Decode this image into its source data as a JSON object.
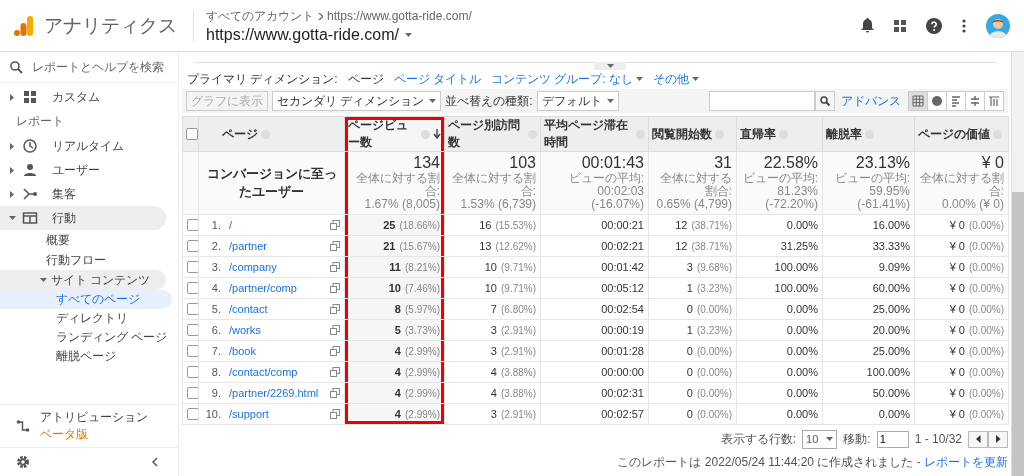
{
  "header": {
    "app_name": "アナリティクス",
    "breadcrumb": [
      "すべてのアカウント",
      "https://www.gotta-ride.com/"
    ],
    "property": "https://www.gotta-ride.com/"
  },
  "sidebar": {
    "search_placeholder": "レポートとヘルプを検索",
    "items": [
      {
        "kind": "item",
        "label": "カスタム",
        "expanded": false
      },
      {
        "kind": "section",
        "label": "レポート"
      },
      {
        "kind": "item",
        "label": "リアルタイム",
        "expanded": false
      },
      {
        "kind": "item",
        "label": "ユーザー",
        "expanded": false
      },
      {
        "kind": "item",
        "label": "集客",
        "expanded": false
      },
      {
        "kind": "item",
        "label": "行動",
        "expanded": true,
        "children": [
          {
            "label": "概要",
            "selected": false
          },
          {
            "label": "行動フロー",
            "selected": false
          },
          {
            "label": "サイト コンテンツ",
            "expanded": true,
            "children": [
              {
                "label": "すべてのページ",
                "selected": true
              },
              {
                "label": "ディレクトリ",
                "selected": false
              },
              {
                "label": "ランディング ページ",
                "selected": false
              },
              {
                "label": "離脱ページ",
                "selected": false
              }
            ]
          }
        ]
      }
    ],
    "bottom_item": {
      "label": "アトリビューション",
      "badge": "ベータ版"
    }
  },
  "dimension_bar": {
    "label": "プライマリ ディメンション:",
    "options": [
      {
        "label": "ページ",
        "selected": true,
        "dropdown": false
      },
      {
        "label": "ページ タイトル",
        "selected": false,
        "dropdown": false
      },
      {
        "label": "コンテンツ グループ: なし",
        "selected": false,
        "dropdown": true
      },
      {
        "label": "その他",
        "selected": false,
        "dropdown": true
      }
    ]
  },
  "toolbar": {
    "chart_button": {
      "label": "グラフに表示",
      "disabled": true
    },
    "secondary_dimension": "セカンダリ ディメンション",
    "sort_label": "並べ替えの種類:",
    "sort_value": "デフォルト",
    "advanced_link": "アドバンス",
    "views": [
      {
        "kind": "table",
        "selected": true
      },
      {
        "kind": "pie",
        "selected": false
      },
      {
        "kind": "bar",
        "selected": false
      },
      {
        "kind": "compare",
        "selected": false
      },
      {
        "kind": "pivot",
        "selected": false
      }
    ]
  },
  "table": {
    "all_checked": false,
    "columns": [
      {
        "label": "ページ",
        "sorted": false,
        "highlighted": false
      },
      {
        "label": "ページビュー数",
        "sorted": true,
        "highlighted": true
      },
      {
        "label": "ページ別訪問数",
        "sorted": false,
        "highlighted": false
      },
      {
        "label": "平均ページ滞在時間",
        "sorted": false,
        "highlighted": false
      },
      {
        "label": "閲覧開始数",
        "sorted": false,
        "highlighted": false
      },
      {
        "label": "直帰率",
        "sorted": false,
        "highlighted": false
      },
      {
        "label": "離脱率",
        "sorted": false,
        "highlighted": false
      },
      {
        "label": "ページの価値",
        "sorted": false,
        "highlighted": false
      }
    ],
    "summary": [
      {
        "value": "コンバージョンに至ったユーザー"
      },
      {
        "value": "134",
        "notes": [
          "全体に対する割合:",
          "1.67% (8,005)"
        ]
      },
      {
        "value": "103",
        "notes": [
          "全体に対する割合:",
          "1.53% (6,739)"
        ]
      },
      {
        "value": "00:01:43",
        "notes": [
          "ビューの平均: 00:02:03",
          "(-16.07%)"
        ]
      },
      {
        "value": "31",
        "notes": [
          "全体に対する割合:",
          "0.65% (4,799)"
        ]
      },
      {
        "value": "22.58%",
        "notes": [
          "ビューの平均: 81.23%",
          "(-72.20%)"
        ]
      },
      {
        "value": "23.13%",
        "notes": [
          "ビューの平均: 59.95%",
          "(-61.41%)"
        ]
      },
      {
        "value": "¥ 0",
        "notes": [
          "全体に対する割合:",
          "0.00% (¥ 0)"
        ]
      }
    ],
    "rows": [
      {
        "checked": false,
        "cells": [
          {
            "rank": "1.",
            "value": "/"
          },
          {
            "value": "25",
            "share": "(18.66%)"
          },
          {
            "value": "16",
            "share": "(15.53%)"
          },
          {
            "value": "00:00:21"
          },
          {
            "value": "12",
            "share": "(38.71%)"
          },
          {
            "value": "0.00%"
          },
          {
            "value": "16.00%"
          },
          {
            "value": "¥ 0",
            "share": "(0.00%)"
          }
        ]
      },
      {
        "checked": false,
        "cells": [
          {
            "rank": "2.",
            "value": "/partner"
          },
          {
            "value": "21",
            "share": "(15.67%)"
          },
          {
            "value": "13",
            "share": "(12.62%)"
          },
          {
            "value": "00:02:21"
          },
          {
            "value": "12",
            "share": "(38.71%)"
          },
          {
            "value": "31.25%"
          },
          {
            "value": "33.33%"
          },
          {
            "value": "¥ 0",
            "share": "(0.00%)"
          }
        ]
      },
      {
        "checked": false,
        "cells": [
          {
            "rank": "3.",
            "value": "/company"
          },
          {
            "value": "11",
            "share": "(8.21%)"
          },
          {
            "value": "10",
            "share": "(9.71%)"
          },
          {
            "value": "00:01:42"
          },
          {
            "value": "3",
            "share": "(9.68%)"
          },
          {
            "value": "100.00%"
          },
          {
            "value": "9.09%"
          },
          {
            "value": "¥ 0",
            "share": "(0.00%)"
          }
        ]
      },
      {
        "checked": false,
        "cells": [
          {
            "rank": "4.",
            "value": "/partner/comp"
          },
          {
            "value": "10",
            "share": "(7.46%)"
          },
          {
            "value": "10",
            "share": "(9.71%)"
          },
          {
            "value": "00:05:12"
          },
          {
            "value": "1",
            "share": "(3.23%)"
          },
          {
            "value": "100.00%"
          },
          {
            "value": "60.00%"
          },
          {
            "value": "¥ 0",
            "share": "(0.00%)"
          }
        ]
      },
      {
        "checked": false,
        "cells": [
          {
            "rank": "5.",
            "value": "/contact"
          },
          {
            "value": "8",
            "share": "(5.97%)"
          },
          {
            "value": "7",
            "share": "(6.80%)"
          },
          {
            "value": "00:02:54"
          },
          {
            "value": "0",
            "share": "(0.00%)"
          },
          {
            "value": "0.00%"
          },
          {
            "value": "25.00%"
          },
          {
            "value": "¥ 0",
            "share": "(0.00%)"
          }
        ]
      },
      {
        "checked": false,
        "cells": [
          {
            "rank": "6.",
            "value": "/works"
          },
          {
            "value": "5",
            "share": "(3.73%)"
          },
          {
            "value": "3",
            "share": "(2.91%)"
          },
          {
            "value": "00:00:19"
          },
          {
            "value": "1",
            "share": "(3.23%)"
          },
          {
            "value": "0.00%"
          },
          {
            "value": "20.00%"
          },
          {
            "value": "¥ 0",
            "share": "(0.00%)"
          }
        ]
      },
      {
        "checked": false,
        "cells": [
          {
            "rank": "7.",
            "value": "/book"
          },
          {
            "value": "4",
            "share": "(2.99%)"
          },
          {
            "value": "3",
            "share": "(2.91%)"
          },
          {
            "value": "00:01:28"
          },
          {
            "value": "0",
            "share": "(0.00%)"
          },
          {
            "value": "0.00%"
          },
          {
            "value": "25.00%"
          },
          {
            "value": "¥ 0",
            "share": "(0.00%)"
          }
        ]
      },
      {
        "checked": false,
        "cells": [
          {
            "rank": "8.",
            "value": "/contact/comp"
          },
          {
            "value": "4",
            "share": "(2.99%)"
          },
          {
            "value": "4",
            "share": "(3.88%)"
          },
          {
            "value": "00:00:00"
          },
          {
            "value": "0",
            "share": "(0.00%)"
          },
          {
            "value": "0.00%"
          },
          {
            "value": "100.00%"
          },
          {
            "value": "¥ 0",
            "share": "(0.00%)"
          }
        ]
      },
      {
        "checked": false,
        "cells": [
          {
            "rank": "9.",
            "value": "/partner/2269.html"
          },
          {
            "value": "4",
            "share": "(2.99%)"
          },
          {
            "value": "4",
            "share": "(3.88%)"
          },
          {
            "value": "00:02:31"
          },
          {
            "value": "0",
            "share": "(0.00%)"
          },
          {
            "value": "0.00%"
          },
          {
            "value": "50.00%"
          },
          {
            "value": "¥ 0",
            "share": "(0.00%)"
          }
        ]
      },
      {
        "checked": false,
        "cells": [
          {
            "rank": "10.",
            "value": "/support"
          },
          {
            "value": "4",
            "share": "(2.99%)"
          },
          {
            "value": "3",
            "share": "(2.91%)"
          },
          {
            "value": "00:02:57"
          },
          {
            "value": "0",
            "share": "(0.00%)"
          },
          {
            "value": "0.00%"
          },
          {
            "value": "0.00%"
          },
          {
            "value": "¥ 0",
            "share": "(0.00%)"
          }
        ]
      }
    ]
  },
  "pagination": {
    "rows_label": "表示する行数:",
    "rows_value": "10",
    "goto_label": "移動:",
    "goto_value": "1",
    "range": "1 - 10/32"
  },
  "report_note": {
    "text": "このレポートは 2022/05/24 11:44:20 に作成されました - ",
    "link": "レポートを更新"
  }
}
